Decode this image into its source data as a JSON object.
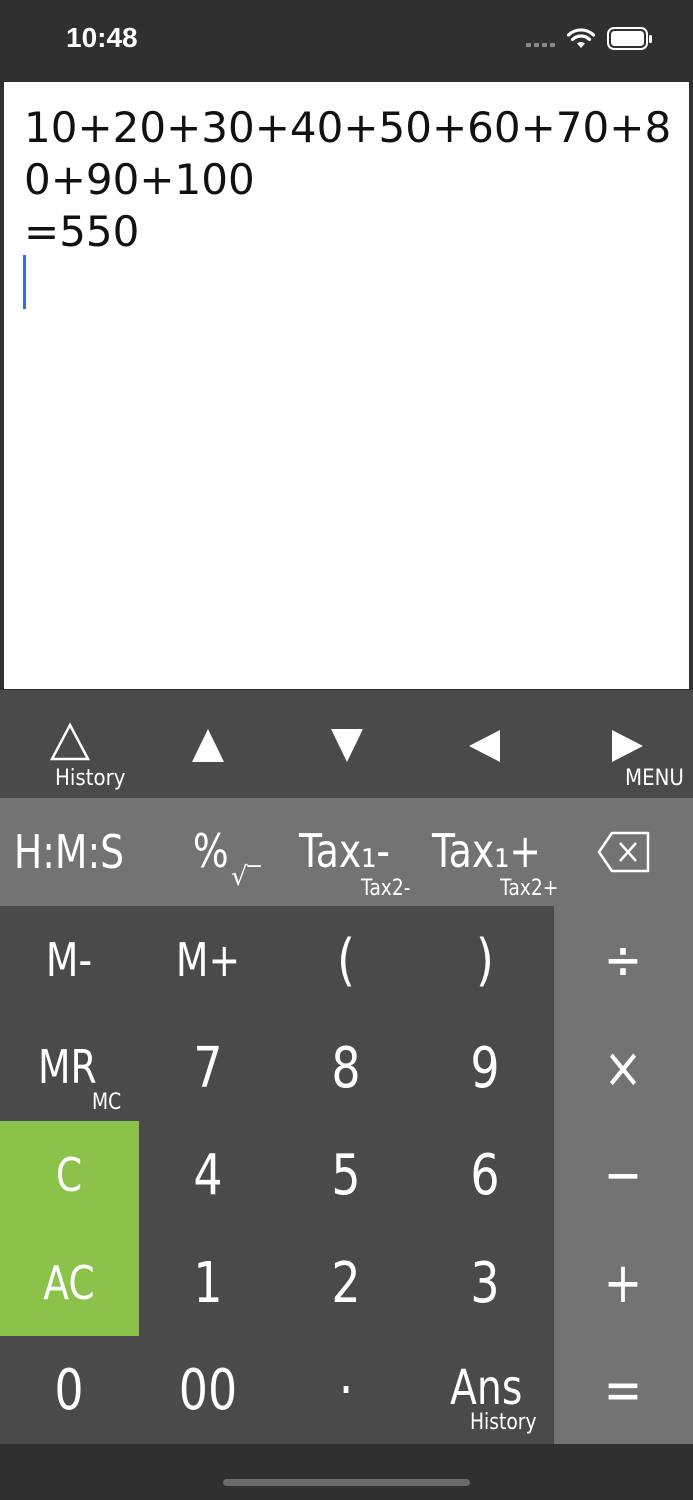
{
  "status": {
    "time": "10:48"
  },
  "display": {
    "expression": "10+20+30+40+50+60+70+80+90+100",
    "result": "=550"
  },
  "nav": {
    "history_label": "History",
    "menu_label": "MENU"
  },
  "func": {
    "hms": "H:M:S",
    "percent": "%",
    "percent_sub": "√‾",
    "tax_minus": "Tax₁-",
    "tax_minus_sub": "Tax2-",
    "tax_plus": "Tax₁+",
    "tax_plus_sub": "Tax2+"
  },
  "keys": {
    "m_minus": "M-",
    "m_plus": "M+",
    "paren_open": "(",
    "paren_close": ")",
    "mr": "MR",
    "mr_sub": "MC",
    "seven": "7",
    "eight": "8",
    "nine": "9",
    "c": "C",
    "four": "4",
    "five": "5",
    "six": "6",
    "ac": "AC",
    "one": "1",
    "two": "2",
    "three": "3",
    "zero": "0",
    "double_zero": "00",
    "dot": "·",
    "ans": "Ans",
    "ans_sub": "History"
  },
  "ops": {
    "divide": "÷",
    "multiply": "×",
    "minus": "−",
    "plus": "+",
    "equals": "="
  },
  "colors": {
    "accent_green": "#8bc34a",
    "dark_key": "#4a4a4a",
    "light_key": "#737373",
    "cursor": "#3b6be0"
  }
}
